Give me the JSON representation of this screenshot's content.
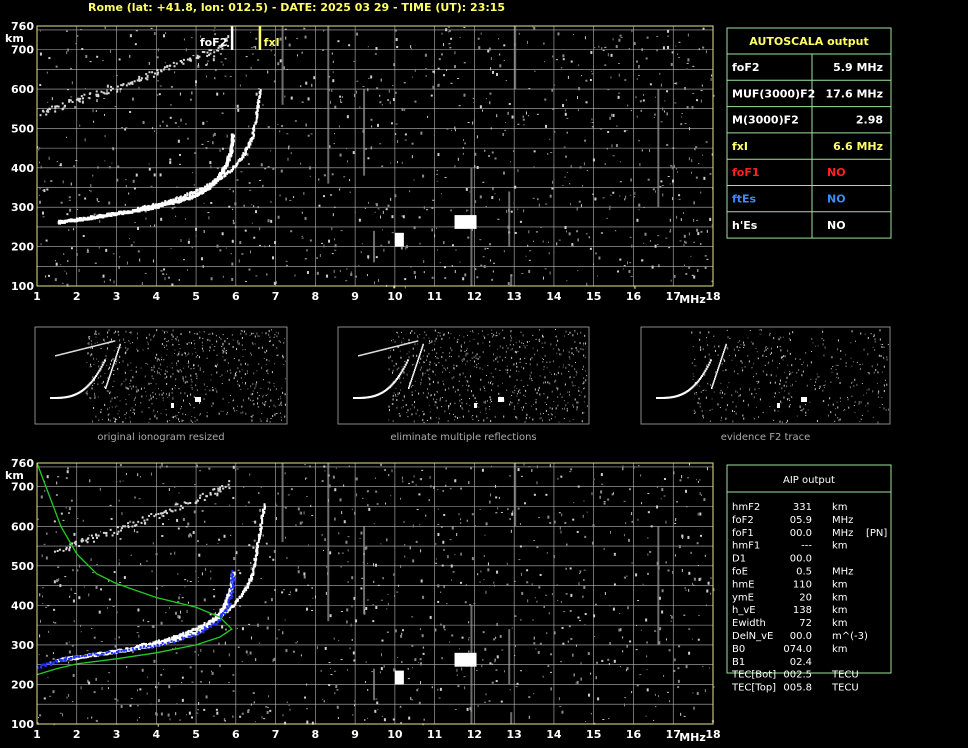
{
  "header": {
    "title": "Rome (lat: +41.8, lon: 012.5) - DATE: 2025 03 29 - TIME (UT): 23:15"
  },
  "colors": {
    "frame": "#e6e68a",
    "grid": "#b8b8b8",
    "table_border": "#9be29b",
    "yellow": "#ffff66",
    "red": "#ff2020",
    "blue": "#3a8cff",
    "green_profile": "#22cc22",
    "blue_trace": "#2233ff"
  },
  "autoscala": {
    "title": "AUTOSCALA output",
    "rows": [
      {
        "label": "foF2",
        "value": "5.9 MHz",
        "color": "#ffffff"
      },
      {
        "label": "MUF(3000)F2",
        "value": "17.6 MHz",
        "color": "#ffffff"
      },
      {
        "label": "M(3000)F2",
        "value": "2.98",
        "color": "#ffffff"
      },
      {
        "label": "fxI",
        "value": "6.6 MHz",
        "color": "#ffff66"
      },
      {
        "label": "foF1",
        "value": "NO",
        "color": "#ff2020"
      },
      {
        "label": "ftEs",
        "value": "NO",
        "color": "#3a8cff"
      },
      {
        "label": "h'Es",
        "value": "NO",
        "color": "#ffffff"
      }
    ]
  },
  "aip": {
    "title": "AIP output",
    "rows": [
      {
        "name": "hmF2",
        "value": "331",
        "unit": "km",
        "extra": ""
      },
      {
        "name": "foF2",
        "value": "05.9",
        "unit": "MHz",
        "extra": ""
      },
      {
        "name": "foF1",
        "value": "00.0",
        "unit": "MHz",
        "extra": "[PN]"
      },
      {
        "name": "hmF1",
        "value": "---",
        "unit": "km",
        "extra": ""
      },
      {
        "name": "D1",
        "value": "00.0",
        "unit": "",
        "extra": ""
      },
      {
        "name": "foE",
        "value": "0.5",
        "unit": "MHz",
        "extra": ""
      },
      {
        "name": "hmE",
        "value": "110",
        "unit": "km",
        "extra": ""
      },
      {
        "name": "ymE",
        "value": "20",
        "unit": "km",
        "extra": ""
      },
      {
        "name": "h_vE",
        "value": "138",
        "unit": "km",
        "extra": ""
      },
      {
        "name": "Ewidth",
        "value": "72",
        "unit": "km",
        "extra": ""
      },
      {
        "name": "DelN_vE",
        "value": "00.0",
        "unit": "m^(-3)",
        "extra": ""
      },
      {
        "name": "B0",
        "value": "074.0",
        "unit": "km",
        "extra": ""
      },
      {
        "name": "B1",
        "value": "02.4",
        "unit": "",
        "extra": ""
      },
      {
        "name": "TEC[Bot]",
        "value": "002.5",
        "unit": "TECU",
        "extra": ""
      },
      {
        "name": "TEC[Top]",
        "value": "005.8",
        "unit": "TECU",
        "extra": ""
      }
    ]
  },
  "thumbnails": [
    {
      "caption": "original ionogram resized"
    },
    {
      "caption": "eliminate multiple reflections"
    },
    {
      "caption": "evidence F2 trace"
    }
  ],
  "chart_data": [
    {
      "type": "scatter",
      "name": "top-ionogram",
      "xunit": "MHz",
      "yunit": "km",
      "xlim": [
        1,
        18
      ],
      "ylim": [
        100,
        760
      ],
      "xticks": [
        "1",
        "2",
        "3",
        "4",
        "5",
        "6",
        "7",
        "8",
        "9",
        "10",
        "11",
        "12",
        "13",
        "14",
        "15",
        "16",
        "17",
        "18"
      ],
      "yticks": [
        "100",
        "200",
        "300",
        "400",
        "500",
        "600",
        "700",
        "760"
      ],
      "grid": true,
      "markers": [
        {
          "label": "foF2",
          "x": 5.9,
          "color": "#ffffff"
        },
        {
          "label": "fxI",
          "x": 6.6,
          "color": "#ffff66"
        }
      ],
      "trace_o": [
        [
          1.5,
          265
        ],
        [
          2,
          272
        ],
        [
          2.5,
          280
        ],
        [
          3,
          288
        ],
        [
          3.5,
          296
        ],
        [
          4,
          305
        ],
        [
          4.5,
          318
        ],
        [
          5,
          335
        ],
        [
          5.3,
          355
        ],
        [
          5.5,
          375
        ],
        [
          5.7,
          405
        ],
        [
          5.85,
          445
        ],
        [
          5.9,
          490
        ]
      ],
      "trace_x": [
        [
          3.5,
          300
        ],
        [
          4,
          310
        ],
        [
          4.5,
          325
        ],
        [
          5,
          345
        ],
        [
          5.5,
          370
        ],
        [
          5.9,
          400
        ],
        [
          6.2,
          440
        ],
        [
          6.4,
          480
        ],
        [
          6.5,
          540
        ],
        [
          6.6,
          600
        ]
      ],
      "trace_multi": [
        [
          1.1,
          540
        ],
        [
          1.5,
          555
        ],
        [
          2,
          575
        ],
        [
          2.5,
          590
        ],
        [
          3,
          605
        ],
        [
          3.5,
          625
        ],
        [
          4,
          645
        ],
        [
          4.5,
          665
        ],
        [
          5,
          685
        ],
        [
          5.5,
          705
        ],
        [
          5.8,
          725
        ]
      ]
    },
    {
      "type": "scatter",
      "name": "bottom-ionogram",
      "xunit": "MHz",
      "yunit": "km",
      "xlim": [
        1,
        18
      ],
      "ylim": [
        100,
        760
      ],
      "xticks": [
        "1",
        "2",
        "3",
        "4",
        "5",
        "6",
        "7",
        "8",
        "9",
        "10",
        "11",
        "12",
        "13",
        "14",
        "15",
        "16",
        "17",
        "18"
      ],
      "yticks": [
        "100",
        "200",
        "300",
        "400",
        "500",
        "600",
        "700",
        "760"
      ],
      "grid": true,
      "green_profile": [
        [
          1,
          225
        ],
        [
          1.5,
          240
        ],
        [
          2,
          252
        ],
        [
          3,
          265
        ],
        [
          4,
          280
        ],
        [
          5,
          300
        ],
        [
          5.6,
          320
        ],
        [
          5.9,
          340
        ],
        [
          5.6,
          370
        ],
        [
          5,
          395
        ],
        [
          4,
          420
        ],
        [
          3,
          455
        ],
        [
          2.5,
          480
        ],
        [
          2,
          530
        ],
        [
          1.6,
          600
        ],
        [
          1.3,
          680
        ],
        [
          1,
          760
        ]
      ],
      "blue_trace": [
        [
          1,
          245
        ],
        [
          1.5,
          262
        ],
        [
          2,
          272
        ],
        [
          3,
          285
        ],
        [
          4,
          300
        ],
        [
          5,
          330
        ],
        [
          5.5,
          360
        ],
        [
          5.8,
          400
        ],
        [
          5.9,
          450
        ],
        [
          5.9,
          490
        ]
      ],
      "trace_o": [
        [
          1.5,
          265
        ],
        [
          2,
          272
        ],
        [
          2.5,
          280
        ],
        [
          3,
          288
        ],
        [
          3.5,
          296
        ],
        [
          4,
          305
        ],
        [
          4.5,
          318
        ],
        [
          5,
          335
        ],
        [
          5.3,
          355
        ],
        [
          5.5,
          375
        ],
        [
          5.7,
          405
        ],
        [
          5.85,
          445
        ],
        [
          5.9,
          490
        ]
      ],
      "trace_x": [
        [
          3.5,
          300
        ],
        [
          4,
          310
        ],
        [
          4.5,
          325
        ],
        [
          5,
          345
        ],
        [
          5.5,
          370
        ],
        [
          5.9,
          400
        ],
        [
          6.2,
          440
        ],
        [
          6.4,
          480
        ],
        [
          6.5,
          540
        ],
        [
          6.6,
          600
        ],
        [
          6.7,
          660
        ]
      ],
      "trace_multi": [
        [
          1.5,
          540
        ],
        [
          2,
          560
        ],
        [
          2.5,
          575
        ],
        [
          3,
          590
        ],
        [
          3.5,
          610
        ],
        [
          4,
          630
        ],
        [
          4.5,
          650
        ],
        [
          5,
          670
        ],
        [
          5.5,
          690
        ],
        [
          5.8,
          710
        ]
      ]
    }
  ]
}
